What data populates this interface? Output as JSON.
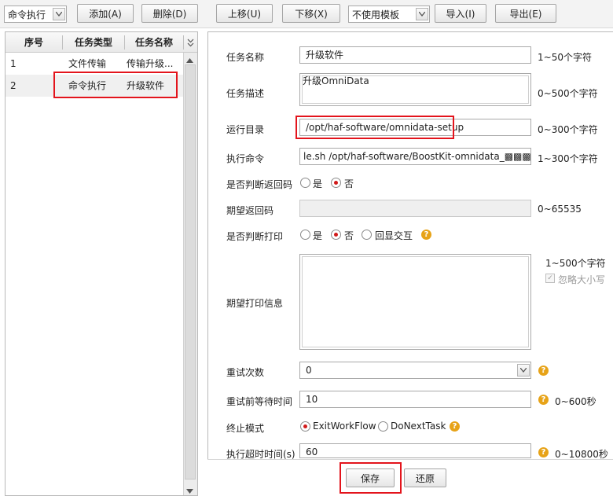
{
  "toolbar": {
    "type_select": "命令执行",
    "add": "添加(A)",
    "delete": "删除(D)",
    "move_up": "上移(U)",
    "move_down": "下移(X)",
    "template_select": "不使用模板",
    "import": "导入(I)",
    "export": "导出(E)"
  },
  "list": {
    "headers": [
      "序号",
      "任务类型",
      "任务名称"
    ],
    "rows": [
      {
        "no": "1",
        "type": "文件传输",
        "name": "传输升级..."
      },
      {
        "no": "2",
        "type": "命令执行",
        "name": "升级软件"
      }
    ]
  },
  "form": {
    "task_name": {
      "label": "任务名称",
      "value": "升级软件",
      "hint": "1~50个字符"
    },
    "task_desc": {
      "label": "任务描述",
      "value": "升级OmniData",
      "hint": "0~500个字符"
    },
    "run_dir": {
      "label": "运行目录",
      "value": "/opt/haf-software/omnidata-setup",
      "hint": "0~300个字符"
    },
    "exec_cmd": {
      "label": "执行命令",
      "value": "le.sh /opt/haf-software/BoostKit-omnidata_▩▩▩.tar.gz",
      "hint": "1~300个字符"
    },
    "judge_return": {
      "label": "是否判断返回码",
      "yes": "是",
      "no": "否",
      "selected": "no"
    },
    "expected_return": {
      "label": "期望返回码",
      "value": "",
      "hint": "0~65535"
    },
    "judge_print": {
      "label": "是否判断打印",
      "yes": "是",
      "no": "否",
      "echo": "回显交互",
      "selected": "no"
    },
    "expected_print": {
      "label": "期望打印信息",
      "value": "",
      "hint": "1~500个字符",
      "ignore_case": "忽略大小写"
    },
    "retry_count": {
      "label": "重试次数",
      "value": "0"
    },
    "retry_wait": {
      "label": "重试前等待时间",
      "value": "10",
      "hint": "0~600秒"
    },
    "stop_mode": {
      "label": "终止模式",
      "opt1": "ExitWorkFlow",
      "opt2": "DoNextTask",
      "selected": "ExitWorkFlow"
    },
    "timeout": {
      "label": "执行超时时间(s)",
      "value": "60",
      "hint": "0~10800秒"
    }
  },
  "footer": {
    "save": "保存",
    "restore": "还原"
  },
  "colors": {
    "highlight_border": "#e3141c",
    "radio_selected": "#d11a1a",
    "help_icon": "#e7a318"
  }
}
